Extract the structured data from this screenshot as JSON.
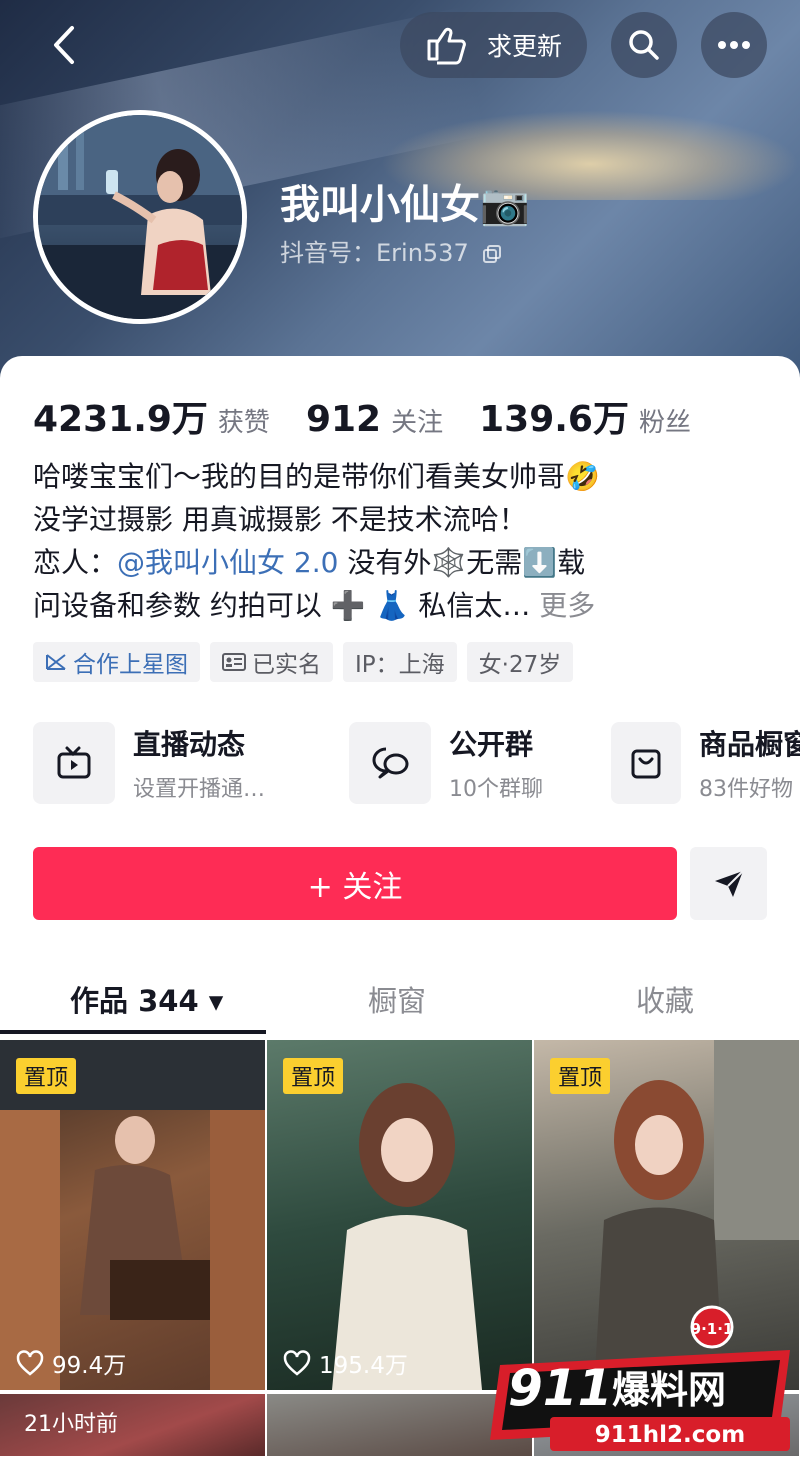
{
  "header": {
    "back_icon": "chevron-left-icon",
    "request_update_label": "求更新",
    "request_update_icon": "thumb-pointing-icon",
    "search_icon": "search-icon",
    "more_icon": "more-dots-icon"
  },
  "profile": {
    "name": "我叫小仙女📷",
    "douyin_id": "抖音号：Erin537",
    "copy_icon": "copy-icon"
  },
  "stats": [
    {
      "value": "4231.9万",
      "label": "获赞"
    },
    {
      "value": "912",
      "label": "关注"
    },
    {
      "value": "139.6万",
      "label": "粉丝"
    }
  ],
  "bio": {
    "line1": "哈喽宝宝们～我的目的是带你们看美女帅哥🤣",
    "line2": "没学过摄影 用真诚摄影 不是技术流哈！",
    "line3_prefix": "恋人：",
    "line3_mention": "@我叫小仙女 2.0",
    "line3_suffix": " 没有外🕸️无需⬇️载",
    "line4": "问设备和参数 约拍可以 ➕ 👗 私信太…",
    "more_label": "更多"
  },
  "tags": [
    {
      "label": "合作上星图",
      "icon": "star-map-icon"
    },
    {
      "label": "已实名",
      "icon": "id-card-icon"
    },
    {
      "label": "IP：上海"
    },
    {
      "label": "女·27岁"
    }
  ],
  "features": [
    {
      "title": "直播动态",
      "subtitle": "设置开播通…",
      "icon": "live-tv-icon"
    },
    {
      "title": "公开群",
      "subtitle": "10个群聊",
      "icon": "chat-bubbles-icon"
    },
    {
      "title": "商品橱窗",
      "subtitle": "83件好物",
      "icon": "shopping-bag-icon"
    }
  ],
  "follow_button": "+ 关注",
  "share_icon": "send-icon",
  "tabs": [
    {
      "label": "作品 344 ▾"
    },
    {
      "label": "橱窗"
    },
    {
      "label": "收藏"
    }
  ],
  "videos": [
    {
      "pin": "置顶",
      "likes": "99.4万"
    },
    {
      "pin": "置顶",
      "likes": "195.4万"
    },
    {
      "pin": "置顶",
      "likes": ""
    },
    {
      "time": "21小时前"
    }
  ],
  "watermark": {
    "badge": "9·1·1",
    "brand_num": "911",
    "brand_text": "爆料网",
    "domain": "911hl2.com"
  },
  "colors": {
    "accent": "#fe2c55",
    "pin": "#fbcf2f",
    "mention": "#3c6fb6"
  }
}
